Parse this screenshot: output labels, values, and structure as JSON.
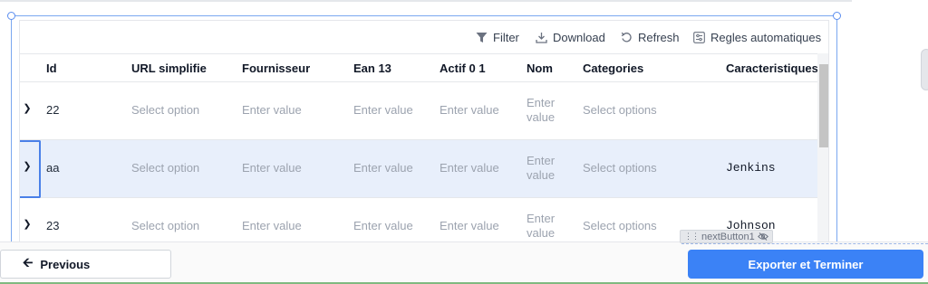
{
  "toolbar": {
    "filter": "Filter",
    "download": "Download",
    "refresh": "Refresh",
    "rules": "Regles automatiques"
  },
  "columns": [
    "Id",
    "URL simplifie",
    "Fournisseur",
    "Ean 13",
    "Actif 0 1",
    "Nom",
    "Categories",
    "Caracteristiques"
  ],
  "rows": [
    {
      "id": "22",
      "url": "Select option",
      "fournisseur": "Enter value",
      "ean": "Enter value",
      "actif": "Enter value",
      "nom_line1": "Enter",
      "nom_line2": "value",
      "categories": "Select options",
      "caracteristiques": "",
      "selected": false
    },
    {
      "id": "aa",
      "url": "Select option",
      "fournisseur": "Enter value",
      "ean": "Enter value",
      "actif": "Enter value",
      "nom_line1": "Enter",
      "nom_line2": "value",
      "categories": "Select options",
      "caracteristiques": "Jenkins",
      "selected": true
    },
    {
      "id": "23",
      "url": "Select option",
      "fournisseur": "Enter value",
      "ean": "Enter value",
      "actif": "Enter value",
      "nom_line1": "Enter",
      "nom_line2": "value",
      "categories": "Select options",
      "caracteristiques": "Johnson",
      "selected": false
    }
  ],
  "footer": {
    "previous": "Previous",
    "next": "Exporter et Terminer",
    "widget_tag": "nextButton1"
  },
  "icons": {
    "filter": "filter-icon",
    "download": "download-icon",
    "refresh": "refresh-icon",
    "rules": "settings-sliders-icon",
    "previous": "arrow-left-icon",
    "expand": "chevron-right-icon",
    "hidden": "eye-off-icon",
    "drag": "drag-handle-icon"
  },
  "colors": {
    "primary": "#3b82f6",
    "selected_row": "#e8effb",
    "selection_frame": "#7aa7f0"
  }
}
